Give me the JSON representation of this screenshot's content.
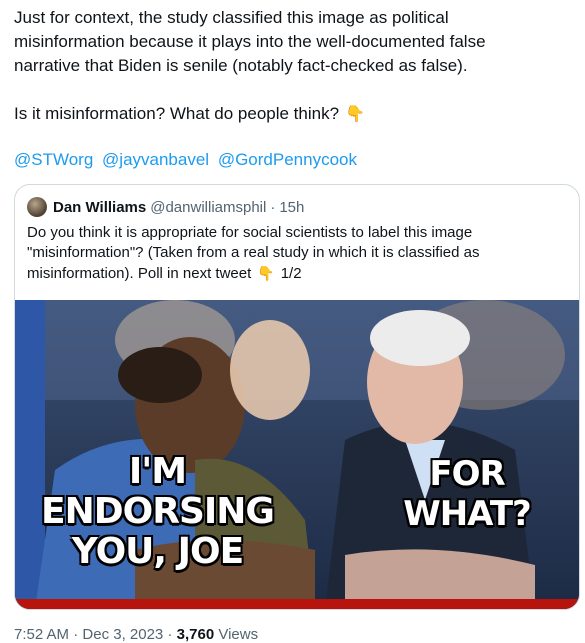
{
  "tweet": {
    "lines": [
      "Just for context, the study classified this image as political",
      "misinformation because it plays into the well-documented false",
      "narrative that Biden is senile (notably fact-checked as false)."
    ],
    "question": "Is it misinformation? What do people think?",
    "question_emoji": "👇",
    "mentions": [
      "@STWorg",
      "@jayvanbavel",
      "@GordPennycook"
    ]
  },
  "quote": {
    "author_name": "Dan Williams",
    "author_handle": "@danwilliamsphil",
    "dot": "·",
    "time": "15h",
    "text_lines": [
      "Do you think it is appropriate for social scientists to label this image",
      "\"misinformation\"? (Taken from a real study in which it is classified as",
      "misinformation). Poll in next tweet"
    ],
    "emoji": "👇",
    "thread_count": "1/2",
    "meme_left_1": "I'M ENDORSING",
    "meme_left_2": "YOU, JOE",
    "meme_right": "FOR WHAT?"
  },
  "meta": {
    "time": "7:52 AM",
    "dot": "·",
    "date": "Dec 3, 2023",
    "views_count": "3,760",
    "views_label": "Views"
  }
}
